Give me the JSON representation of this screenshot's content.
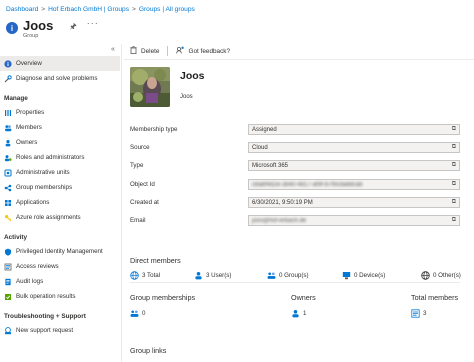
{
  "breadcrumb": [
    "Dashboard",
    "Hof Erbach GmbH | Groups",
    "Groups | All groups"
  ],
  "header": {
    "title": "Joos",
    "subtitle": "Group"
  },
  "sidebar": {
    "top": [
      {
        "label": "Overview",
        "icon": "info-icon",
        "active": true
      },
      {
        "label": "Diagnose and solve problems",
        "icon": "wrench-icon",
        "active": false
      }
    ],
    "manage_heading": "Manage",
    "manage": [
      {
        "label": "Properties",
        "icon": "properties-icon"
      },
      {
        "label": "Members",
        "icon": "members-icon"
      },
      {
        "label": "Owners",
        "icon": "owners-icon"
      },
      {
        "label": "Roles and administrators",
        "icon": "roles-icon"
      },
      {
        "label": "Administrative units",
        "icon": "admin-units-icon"
      },
      {
        "label": "Group memberships",
        "icon": "group-memberships-icon"
      },
      {
        "label": "Applications",
        "icon": "applications-icon"
      },
      {
        "label": "Azure role assignments",
        "icon": "key-icon"
      }
    ],
    "activity_heading": "Activity",
    "activity": [
      {
        "label": "Privileged Identity Management",
        "icon": "pim-icon"
      },
      {
        "label": "Access reviews",
        "icon": "access-reviews-icon"
      },
      {
        "label": "Audit logs",
        "icon": "audit-logs-icon"
      },
      {
        "label": "Bulk operation results",
        "icon": "bulk-results-icon"
      }
    ],
    "support_heading": "Troubleshooting + Support",
    "support": [
      {
        "label": "New support request",
        "icon": "support-icon"
      }
    ]
  },
  "toolbar": {
    "delete_label": "Delete",
    "feedback_label": "Got feedback?"
  },
  "entity": {
    "name": "Joos",
    "subname": "Joos"
  },
  "properties": [
    {
      "label": "Membership type",
      "value": "Assigned",
      "blurred": false
    },
    {
      "label": "Source",
      "value": "Cloud",
      "blurred": false
    },
    {
      "label": "Type",
      "value": "Microsoft 365",
      "blurred": false
    },
    {
      "label": "Object Id",
      "value": "c8a8f4d2e-3b40-4817-af9f-b7f9cda8dcab",
      "blurred": true
    },
    {
      "label": "Created at",
      "value": "6/30/2021, 9:50:19 PM",
      "blurred": false
    },
    {
      "label": "Email",
      "value": "joos@hof-erbach.de",
      "blurred": true
    }
  ],
  "direct_members": {
    "title": "Direct members",
    "stats": [
      {
        "value": "3 Total",
        "icon": "globe-icon"
      },
      {
        "value": "3 User(s)",
        "icon": "users-icon"
      },
      {
        "value": "0 Group(s)",
        "icon": "groups-icon"
      },
      {
        "value": "0 Device(s)",
        "icon": "device-icon"
      },
      {
        "value": "0 Other(s)",
        "icon": "globe-icon"
      }
    ]
  },
  "summary": {
    "group_memberships": {
      "title": "Group memberships",
      "value": "0"
    },
    "owners": {
      "title": "Owners",
      "value": "1"
    },
    "total_members": {
      "title": "Total members",
      "value": "3"
    }
  },
  "group_links": {
    "title": "Group links"
  },
  "colors": {
    "accent": "#0078d4",
    "badge": "#2566c6",
    "active_nav": "#edebe9"
  }
}
